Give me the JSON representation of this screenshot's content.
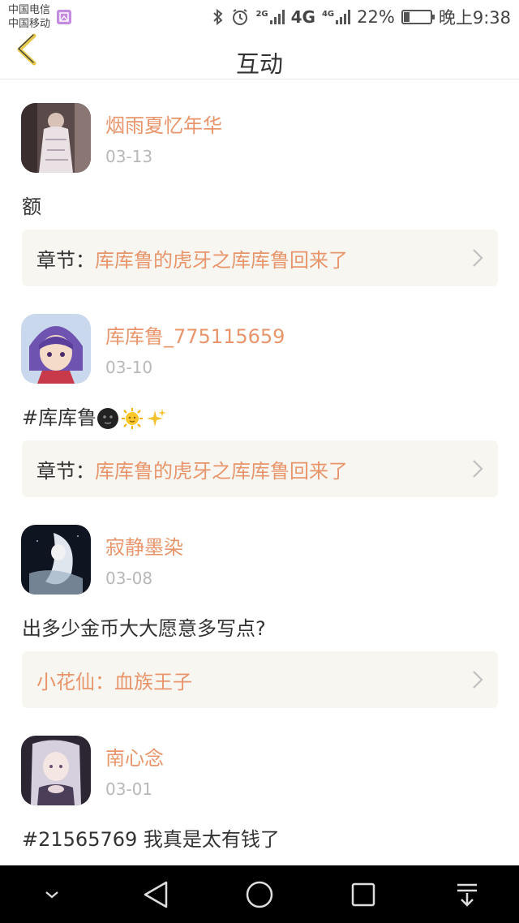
{
  "status_bar": {
    "carrier_1": "中国电信",
    "carrier_2": "中国移动",
    "network_1": "2G",
    "network_2": "4G",
    "network_3": "4G",
    "battery_percent": "22%",
    "battery_level": 0.22,
    "time": "晚上9:38"
  },
  "header": {
    "title": "互动"
  },
  "items": [
    {
      "username": "烟雨夏忆年华",
      "date": "03-13",
      "content": "额",
      "chapter_prefix": "章节：",
      "chapter_title": "库库鲁的虎牙之库库鲁回来了"
    },
    {
      "username": "库库鲁_775115659",
      "date": "03-10",
      "content": "#库库鲁",
      "chapter_prefix": "章节：",
      "chapter_title": "库库鲁的虎牙之库库鲁回来了"
    },
    {
      "username": "寂静墨染",
      "date": "03-08",
      "content": "出多少金币大大愿意多写点?",
      "chapter_prefix": "",
      "chapter_title": "小花仙：血族王子"
    },
    {
      "username": "南心念",
      "date": "03-01",
      "content": "#21565769 我真是太有钱了"
    }
  ],
  "colors": {
    "accent": "#e8956b",
    "chapter_bg": "#f7f6f1",
    "back_arrow": "#e6c94a"
  }
}
